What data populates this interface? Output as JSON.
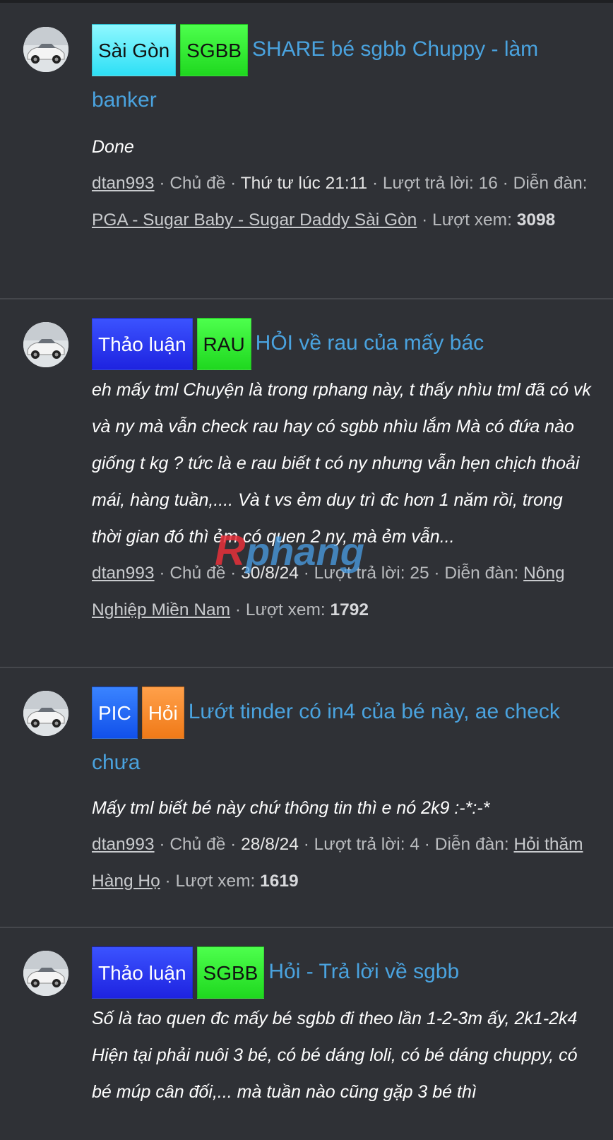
{
  "posts": [
    {
      "tags": [
        {
          "label": "Sài Gòn",
          "bg": "#5ff0ff"
        },
        {
          "label": "SGBB",
          "bg": "#2df52d"
        }
      ],
      "title": "SHARE bé sgbb Chuppy - làm banker",
      "snippet": "Done",
      "author": "dtan993",
      "role": "Chủ đề",
      "date": "Thứ tư lúc 21:11",
      "replies_label": "Lượt trả lời:",
      "replies": "16",
      "forum_label": "Diễn đàn:",
      "forum": "PGA - Sugar Baby - Sugar Daddy Sài Gòn",
      "views_label": "Lượt xem:",
      "views": "3098"
    },
    {
      "tags": [
        {
          "label": "Thảo luận",
          "bg": "#2f3cff",
          "light": true
        },
        {
          "label": "RAU",
          "bg": "#2df52d"
        }
      ],
      "title": "HỎI về rau của mấy bác",
      "snippet": "eh mấy tml Chuyện là trong rphang này, t thấy nhìu tml đã có vk và ny mà vẫn check rau hay có sgbb nhìu lắm Mà có đứa nào giống t kg ? tức là e rau biết t có ny nhưng vẫn hẹn chịch thoải mái, hàng tuần,.... Và t vs ẻm duy trì đc hơn 1 năm rồi, trong thời gian đó thì ẻm có quen 2 ny, mà ẻm vẫn...",
      "author": "dtan993",
      "role": "Chủ đề",
      "date": "30/8/24",
      "replies_label": "Lượt trả lời:",
      "replies": "25",
      "forum_label": "Diễn đàn:",
      "forum": "Nông Nghiệp Miền Nam",
      "views_label": "Lượt xem:",
      "views": "1792"
    },
    {
      "tags": [
        {
          "label": "PIC",
          "bg": "#1f6bff",
          "light": true
        },
        {
          "label": "Hỏi",
          "bg": "#ff8a2a",
          "light": true
        }
      ],
      "title": "Lướt tinder có in4 của bé này, ae check chưa",
      "snippet": "Mấy tml biết bé này chứ thông tin thì e nó 2k9 :-*:-*",
      "author": "dtan993",
      "role": "Chủ đề",
      "date": "28/8/24",
      "replies_label": "Lượt trả lời:",
      "replies": "4",
      "forum_label": "Diễn đàn:",
      "forum": "Hỏi thăm Hàng Họ",
      "views_label": "Lượt xem:",
      "views": "1619"
    },
    {
      "tags": [
        {
          "label": "Thảo luận",
          "bg": "#2f3cff",
          "light": true
        },
        {
          "label": "SGBB",
          "bg": "#2df52d"
        }
      ],
      "title": "Hỏi - Trả lời về sgbb",
      "snippet": "Số là tao quen đc mấy bé sgbb đi theo lần 1-2-3m ấy, 2k1-2k4 Hiện tại phải nuôi 3 bé, có bé dáng loli, có bé dáng chuppy, có bé múp cân đối,... mà tuần nào cũng gặp 3 bé thì"
    }
  ],
  "watermark": "Rphang"
}
